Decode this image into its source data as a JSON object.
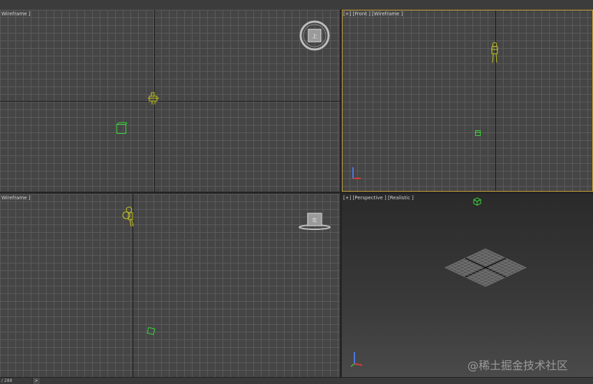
{
  "viewports": {
    "top": {
      "label": "Wireframe ]"
    },
    "front": {
      "label": "[+] [Front ] [Wireframe ]"
    },
    "left": {
      "label": "Wireframe ]"
    },
    "perspective": {
      "label": "[+] [Perspective ] [Realistic ]"
    }
  },
  "viewcube": {
    "top_face": "上",
    "left_face": "左"
  },
  "statusbar": {
    "frame": "/ 288",
    "next": ">"
  },
  "watermark": "@稀土掘金技术社区",
  "colors": {
    "active_border": "#c9a23a",
    "object_green": "#39d639",
    "object_yellow": "#c8c820"
  }
}
